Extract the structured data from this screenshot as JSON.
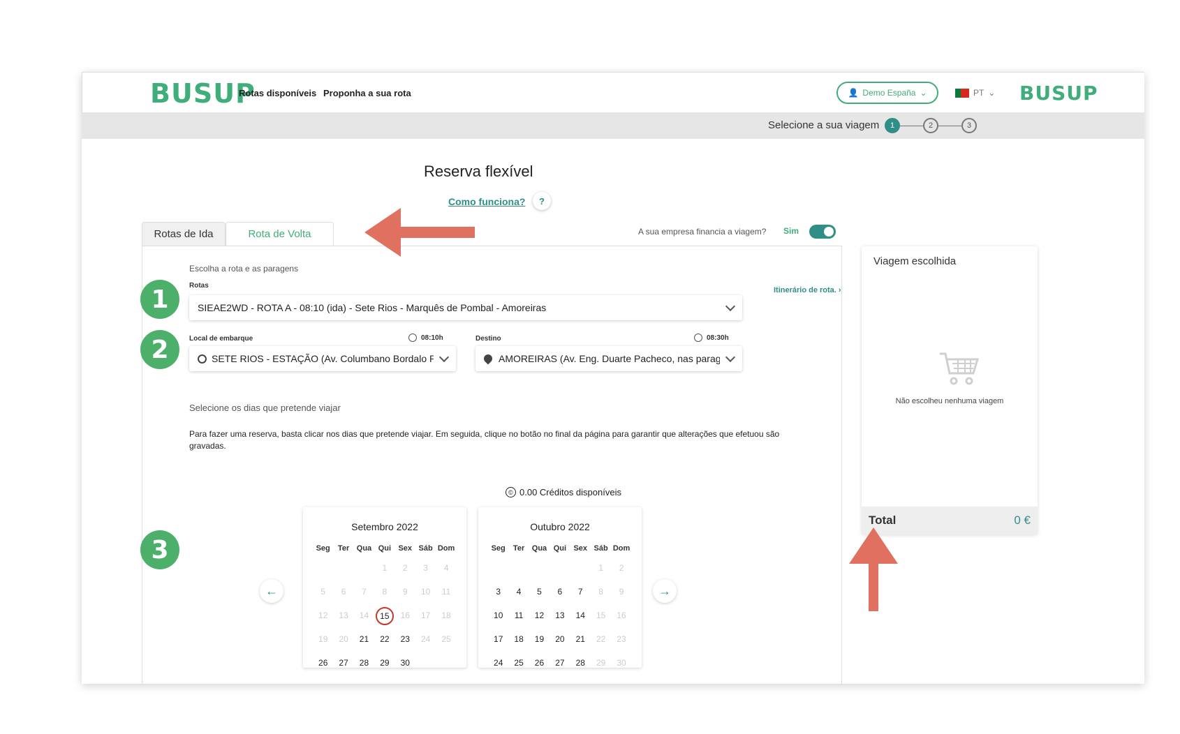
{
  "header": {
    "logo_left": "BUSUP",
    "logo_right": "BUSUP",
    "nav": [
      "Rotas disponíveis",
      "Proponha a sua rota"
    ],
    "account_label": "Demo España",
    "language": "PT"
  },
  "stepper": {
    "label": "Selecione a sua viagem",
    "steps": [
      "1",
      "2",
      "3"
    ],
    "active": 1
  },
  "main": {
    "title": "Reserva flexível",
    "help_link": "Como funciona?",
    "help_icon": "?",
    "tabs": [
      {
        "label": "Rotas de Ida",
        "active": false
      },
      {
        "label": "Rota de Volta",
        "active": true
      }
    ],
    "finance_question": "A sua empresa financia a viagem?",
    "finance_answer": "Sim",
    "finance_toggle_on": true,
    "section_route": "Escolha a rota e as paragens",
    "routes_label": "Rotas",
    "itinerary_link": "Itinerário de rota.",
    "route_value": "SIEAE2WD - ROTA A - 08:10 (ida) - Sete Rios - Marquês de Pombal - Amoreiras",
    "boarding_label": "Local de embarque",
    "boarding_time": "08:10h",
    "boarding_value": "SETE RIOS - ESTAÇÃO (Av. Columbano Bordalo Pinheiro)",
    "destination_label": "Destino",
    "destination_time": "08:30h",
    "destination_value": "AMOREIRAS (Av. Eng. Duarte Pacheco, nas paragens)",
    "days_label": "Selecione os dias que pretende viajar",
    "instructions": "Para fazer uma reserva, basta clicar nos dias que pretende viajar. Em seguida, clique no botão no final da página para garantir que alterações que efetuou são gravadas.",
    "credits_symbol": "©",
    "credits": "0.00 Créditos disponíveis"
  },
  "calendar": {
    "weekdays": [
      "Seg",
      "Ter",
      "Qua",
      "Qui",
      "Sex",
      "Sáb",
      "Dom"
    ],
    "months": [
      {
        "title": "Setembro 2022",
        "days": [
          "",
          "",
          "",
          "1",
          "2",
          "3",
          "4",
          "5",
          "6",
          "7",
          "8",
          "9",
          "10",
          "11",
          "12",
          "13",
          "14",
          "15",
          "16",
          "17",
          "18",
          "19",
          "20",
          "21",
          "22",
          "23",
          "24",
          "25",
          "26",
          "27",
          "28",
          "29",
          "30",
          "",
          ""
        ],
        "available": [
          "21",
          "22",
          "23",
          "26",
          "27",
          "28",
          "29",
          "30"
        ],
        "today": "15"
      },
      {
        "title": "Outubro 2022",
        "days": [
          "",
          "",
          "",
          "",
          "",
          "1",
          "2",
          "3",
          "4",
          "5",
          "6",
          "7",
          "8",
          "9",
          "10",
          "11",
          "12",
          "13",
          "14",
          "15",
          "16",
          "17",
          "18",
          "19",
          "20",
          "21",
          "22",
          "23",
          "24",
          "25",
          "26",
          "27",
          "28",
          "29",
          "30"
        ],
        "available": [
          "3",
          "4",
          "5",
          "6",
          "7",
          "10",
          "11",
          "12",
          "13",
          "14",
          "17",
          "18",
          "19",
          "20",
          "21",
          "24",
          "25",
          "26",
          "27",
          "28"
        ],
        "today": ""
      }
    ],
    "prev_icon": "←",
    "next_icon": "→"
  },
  "sidebar": {
    "title": "Viagem escolhida",
    "empty_text": "Não escolheu nenhuma viagem",
    "total_label": "Total",
    "total_value": "0 €"
  },
  "annotations": {
    "badges": [
      "1",
      "2",
      "3"
    ],
    "badge_color": "#4caf6a",
    "arrow_color": "#e07060"
  },
  "colors": {
    "brand": "#3fae7a",
    "accent": "#2f8f86",
    "today_ring": "#c0392b"
  }
}
